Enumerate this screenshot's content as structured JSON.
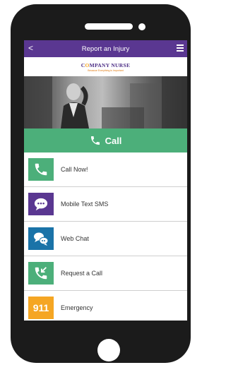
{
  "header": {
    "back": "<",
    "title": "Report an Injury"
  },
  "logo": {
    "name_pre": "C",
    "name_o": "O",
    "name_post": "MPANY NURSE",
    "tagline": "Because Everything is Important"
  },
  "banner": {
    "label": "Call"
  },
  "options": [
    {
      "label": "Call Now!",
      "color": "#4caf7a",
      "icon": "phone-icon"
    },
    {
      "label": "Mobile Text SMS",
      "color": "#5a3791",
      "icon": "chat-bubble-icon"
    },
    {
      "label": "Web Chat",
      "color": "#1a73a8",
      "icon": "web-chat-icon"
    },
    {
      "label": "Request a Call",
      "color": "#4caf7a",
      "icon": "phone-incoming-icon"
    },
    {
      "label": "Emergency",
      "color": "#f5a623",
      "icon": "911-icon",
      "glyph": "911"
    }
  ],
  "colors": {
    "nav": "#5a3791",
    "banner": "#4caf7a",
    "phone_body": "#1b1b1b"
  }
}
